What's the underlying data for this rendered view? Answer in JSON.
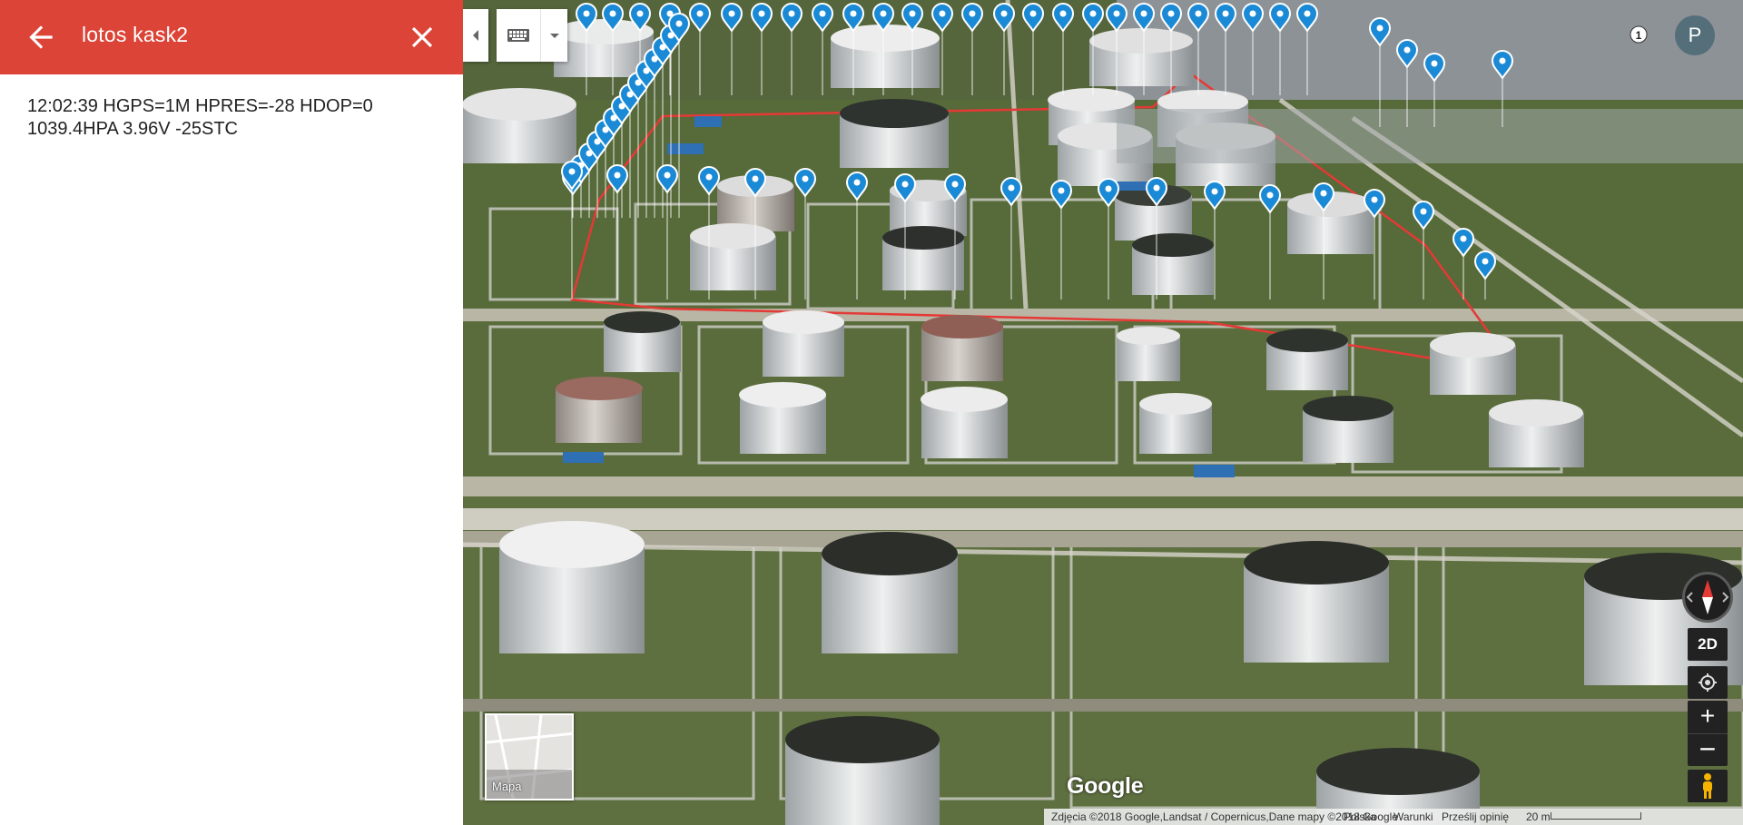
{
  "panel": {
    "title": "lotos kask2",
    "description": "12:02:39 HGPS=1M HPRES=-28 HDOP=0\n1039.4HPA 3.96V -25STC",
    "back_icon": "arrow-left-icon",
    "close_icon": "close-icon",
    "header_color": "#db4437"
  },
  "map": {
    "minimap_label": "Mapa",
    "view_toggle_label": "2D",
    "zoom_in_label": "+",
    "zoom_out_label": "−",
    "avatar_letter": "P",
    "cluster_count": "1",
    "google_logo": "Google",
    "attribution": "Zdjęcia ©2018 Google,Landsat / Copernicus,Dane mapy ©2018 Google",
    "country_link": "Polska",
    "terms_link": "Warunki",
    "feedback_link": "Prześlij opinię",
    "scale_label": "20 m",
    "marker_color": "#1a8ad6",
    "route_color": "#e53935",
    "icons": [
      "keyboard-icon",
      "chevron-down-icon",
      "chevron-left-icon",
      "compass-icon",
      "my-location-icon",
      "pegman-icon",
      "map-marker-icon"
    ]
  }
}
